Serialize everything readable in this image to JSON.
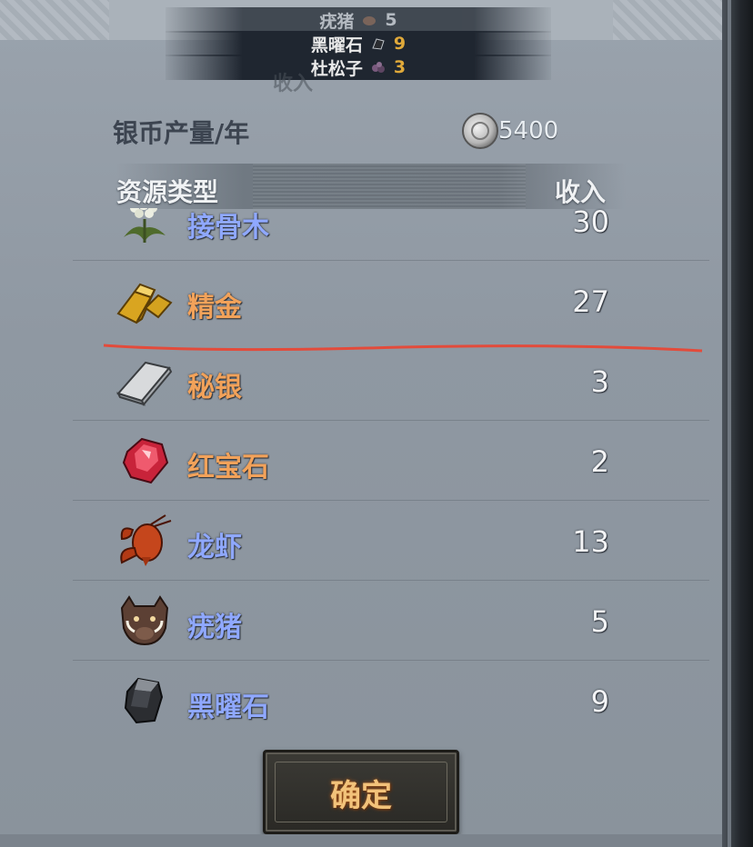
{
  "popup": {
    "rows": [
      {
        "name": "疣猪",
        "value": "5"
      },
      {
        "name": "黑曜石",
        "value": "9"
      },
      {
        "name": "杜松子",
        "value": "3"
      }
    ],
    "faded_title": "收入"
  },
  "silver": {
    "label": "银币产量/年",
    "value": "5400",
    "icon": "silver-coin-icon"
  },
  "table": {
    "header_type": "资源类型",
    "header_income": "收入",
    "rows": [
      {
        "name": "接骨木",
        "value": "30",
        "icon": "elderberry-icon",
        "color": "#8fa8ff"
      },
      {
        "name": "精金",
        "value": "27",
        "icon": "gold-ingot-icon",
        "color": "#f2a25a"
      },
      {
        "name": "秘银",
        "value": "3",
        "icon": "mithril-ingot-icon",
        "color": "#f2a25a"
      },
      {
        "name": "红宝石",
        "value": "2",
        "icon": "ruby-icon",
        "color": "#f2a25a"
      },
      {
        "name": "龙虾",
        "value": "13",
        "icon": "lobster-icon",
        "color": "#8fa8ff"
      },
      {
        "name": "疣猪",
        "value": "5",
        "icon": "warthog-icon",
        "color": "#8fa8ff"
      },
      {
        "name": "黑曜石",
        "value": "9",
        "icon": "obsidian-icon",
        "color": "#8fa8ff"
      }
    ]
  },
  "confirm_label": "确定",
  "annotation_color": "#e34b3b"
}
